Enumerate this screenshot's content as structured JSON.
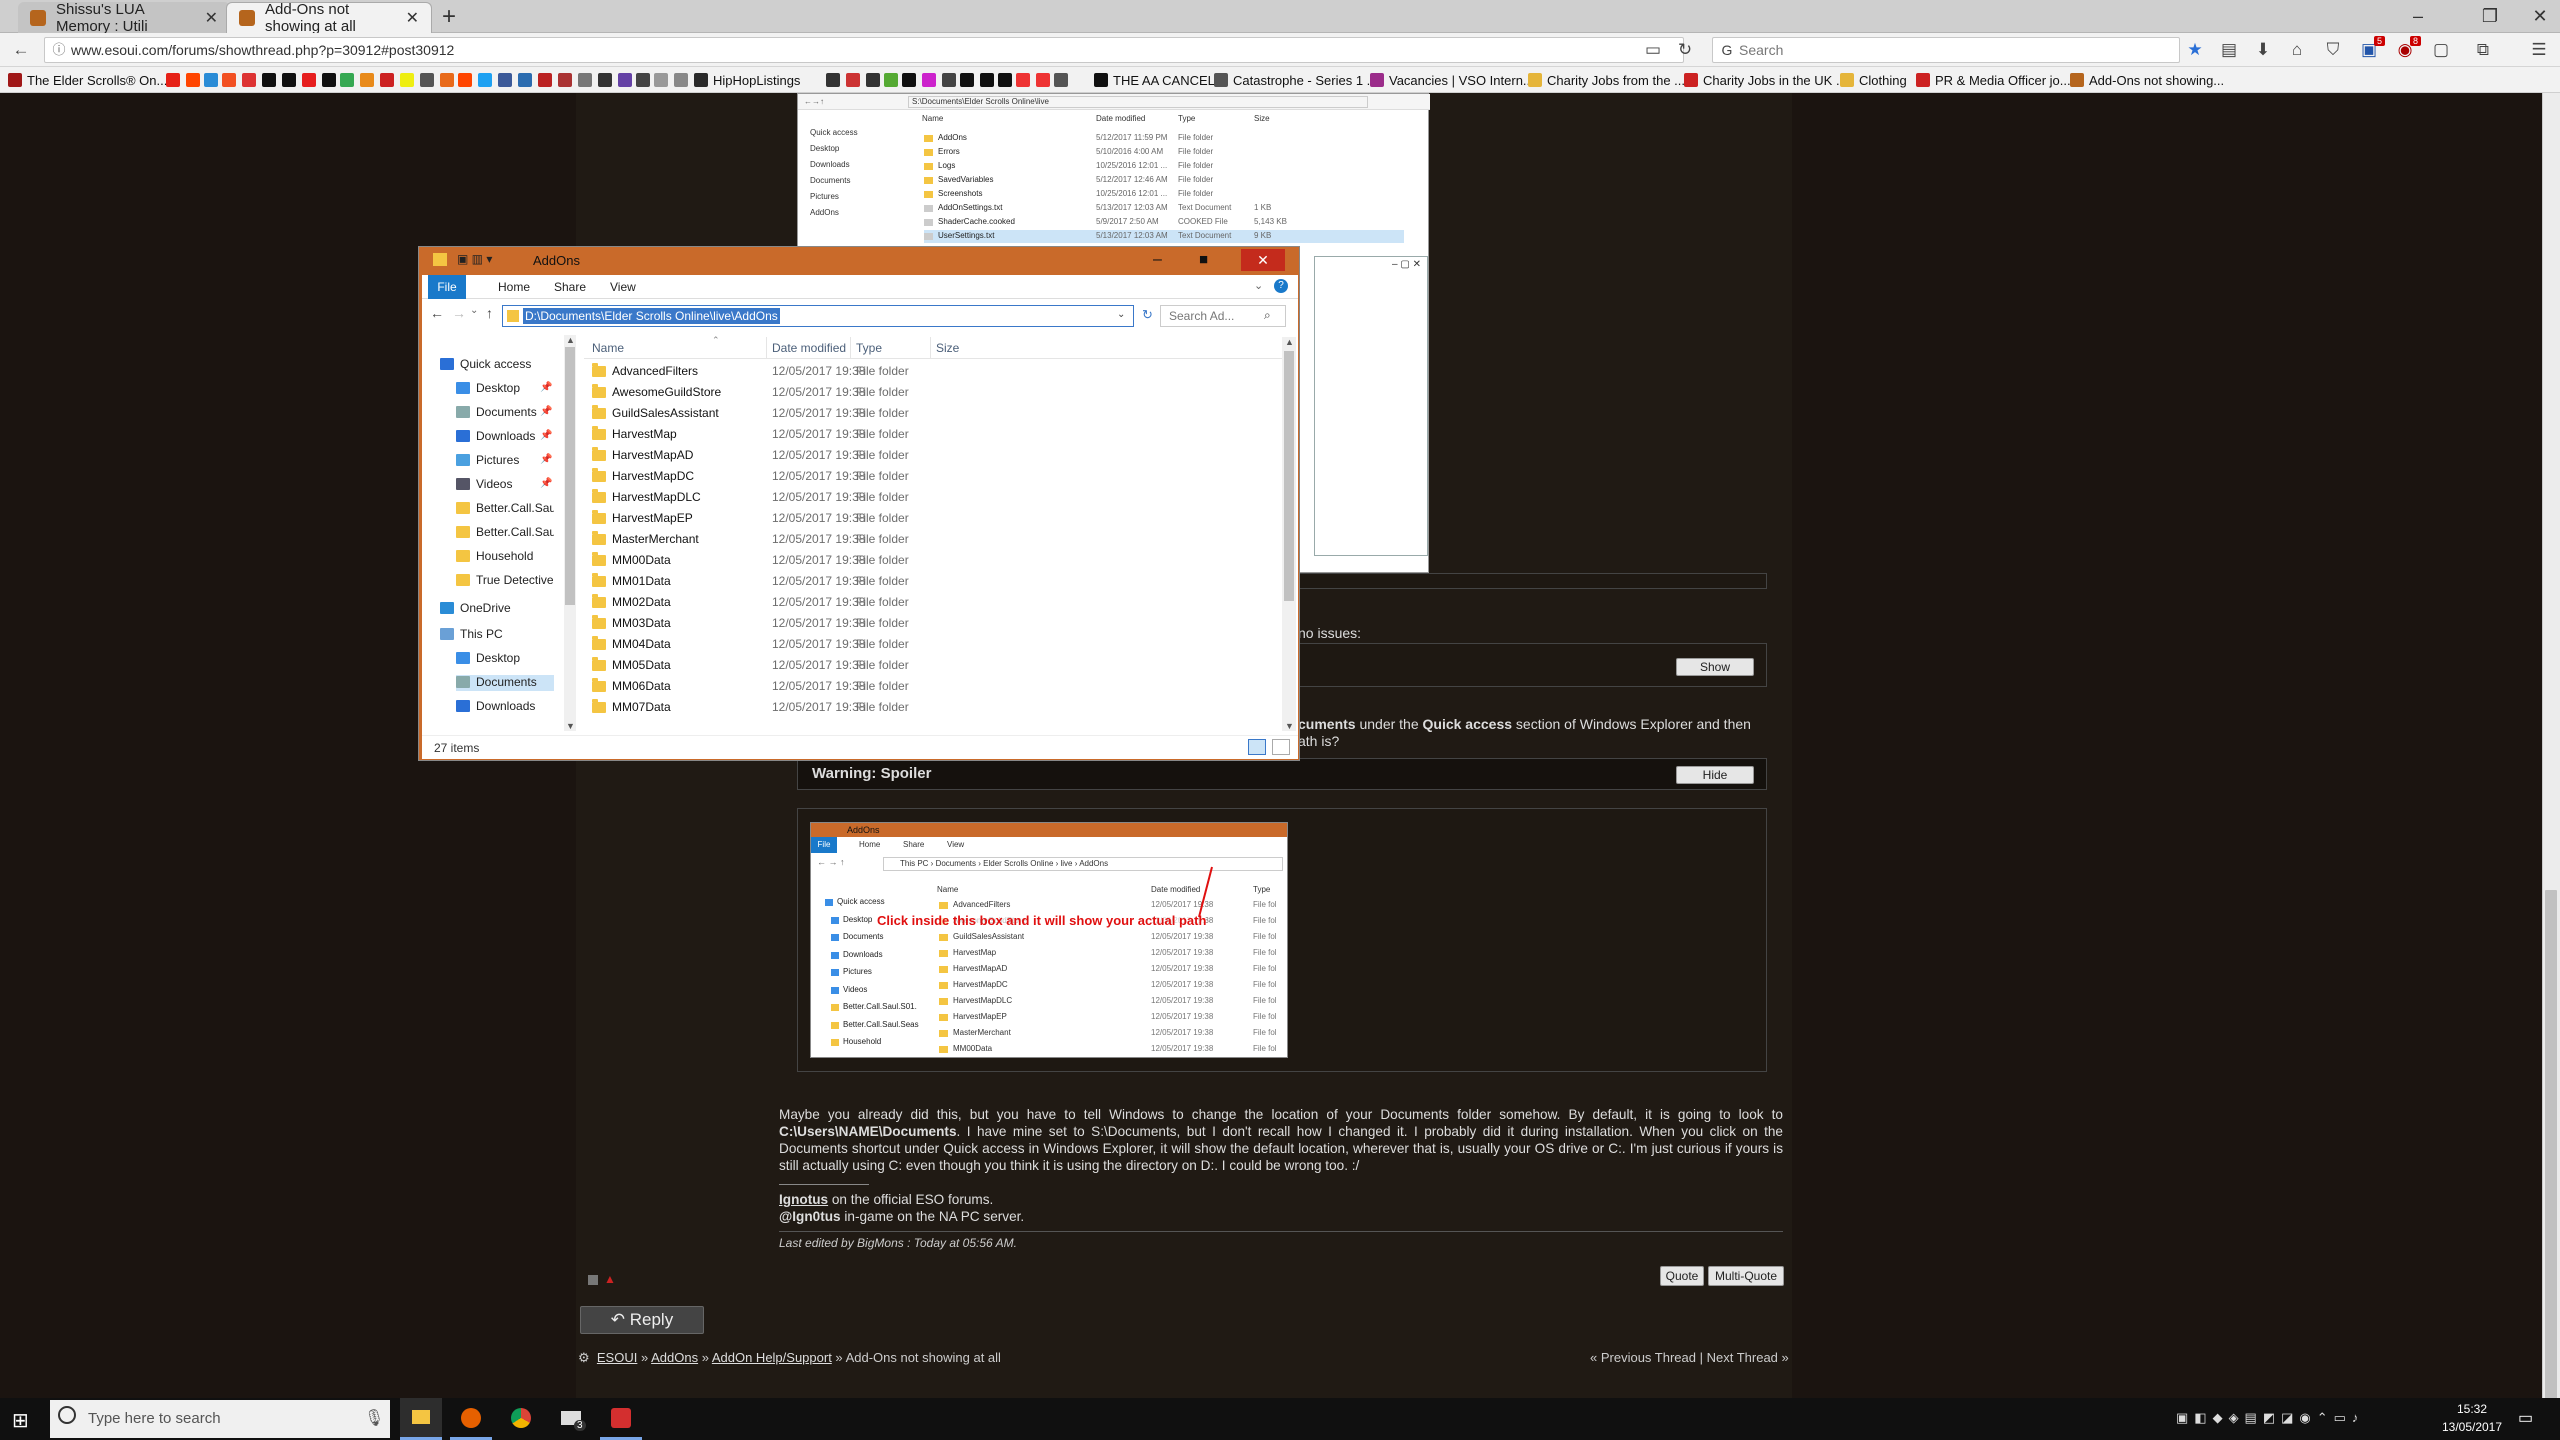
{
  "browser": {
    "tabs": [
      {
        "title": "Shissu's LUA Memory : Utili",
        "active": false
      },
      {
        "title": "Add-Ons not showing at all",
        "active": true
      }
    ],
    "url": "www.esoui.com/forums/showthread.php?p=30912#post30912",
    "search_placeholder": "Search",
    "bookmarks": [
      "The Elder Scrolls® On...",
      "HipHopListings",
      "THE AA CANCEL",
      "Catastrophe - Series 1 ...",
      "Vacancies | VSO Intern...",
      "Charity Jobs from the ...",
      "Charity Jobs in the UK ...",
      "Clothing",
      "PR & Media Officer jo...",
      "Add-Ons not showing..."
    ],
    "badge_counts": [
      "5",
      "8"
    ]
  },
  "explorer": {
    "title": "AddOns",
    "ribbon_tabs": [
      "File",
      "Home",
      "Share",
      "View"
    ],
    "address": "D:\\Documents\\Elder Scrolls Online\\live\\AddOns",
    "search_placeholder": "Search Ad...",
    "columns": [
      "Name",
      "Date modified",
      "Type",
      "Size"
    ],
    "nav": [
      {
        "label": "Quick access"
      },
      {
        "label": "Desktop"
      },
      {
        "label": "Documents"
      },
      {
        "label": "Downloads"
      },
      {
        "label": "Pictures"
      },
      {
        "label": "Videos"
      },
      {
        "label": "Better.Call.Saul.S"
      },
      {
        "label": "Better.Call.Saul.S"
      },
      {
        "label": "Household"
      },
      {
        "label": "True Detective S"
      },
      {
        "label": "OneDrive"
      },
      {
        "label": "This PC"
      },
      {
        "label": "Desktop"
      },
      {
        "label": "Documents"
      },
      {
        "label": "Downloads"
      }
    ],
    "files": [
      "AdvancedFilters",
      "AwesomeGuildStore",
      "GuildSalesAssistant",
      "HarvestMap",
      "HarvestMapAD",
      "HarvestMapDC",
      "HarvestMapDLC",
      "HarvestMapEP",
      "MasterMerchant",
      "MM00Data",
      "MM01Data",
      "MM02Data",
      "MM03Data",
      "MM04Data",
      "MM05Data",
      "MM06Data",
      "MM07Data"
    ],
    "file_date": "12/05/2017 19:38",
    "file_type": "File folder",
    "status": "27 items"
  },
  "bg_explorer": {
    "address": "S:\\Documents\\Elder Scrolls Online\\live",
    "columns": [
      "Name",
      "Date modified",
      "Type",
      "Size"
    ],
    "nav": [
      "Quick access",
      "Desktop",
      "Downloads",
      "Documents",
      "Pictures",
      "AddOns"
    ],
    "rows": [
      {
        "name": "AddOns",
        "date": "5/12/2017 11:59 PM",
        "type": "File folder",
        "size": ""
      },
      {
        "name": "Errors",
        "date": "5/10/2016 4:00 AM",
        "type": "File folder",
        "size": ""
      },
      {
        "name": "Logs",
        "date": "10/25/2016 12:01 ...",
        "type": "File folder",
        "size": ""
      },
      {
        "name": "SavedVariables",
        "date": "5/12/2017 12:46 AM",
        "type": "File folder",
        "size": ""
      },
      {
        "name": "Screenshots",
        "date": "10/25/2016 12:01 ...",
        "type": "File folder",
        "size": ""
      },
      {
        "name": "AddOnSettings.txt",
        "date": "5/13/2017 12:03 AM",
        "type": "Text Document",
        "size": "1 KB"
      },
      {
        "name": "ShaderCache.cooked",
        "date": "5/9/2017 2:50 AM",
        "type": "COOKED File",
        "size": "5,143 KB"
      },
      {
        "name": "UserSettings.txt",
        "date": "5/13/2017 12:03 AM",
        "type": "Text Document",
        "size": "9 KB"
      }
    ]
  },
  "post": {
    "partial_line_1": "no issues:",
    "show_label": "Show",
    "partial_line_2_bold_a": "cuments",
    "partial_line_2_mid": " under the ",
    "partial_line_2_bold_b": "Quick access",
    "partial_line_2_end": " section of Windows Explorer and then",
    "partial_line_3": "ath is?",
    "spoiler_title": "Warning: Spoiler",
    "hide_label": "Hide",
    "body_text": "Maybe you already did this, but you have to tell Windows to change the location of your Documents folder somehow. By default, it is going to look to",
    "body_bold_path": "C:\\Users\\NAME\\Documents",
    "body_text_2": ". I have mine set to S:\\Documents, but I don't recall how I changed it. I probably did it during installation. When you click on the Documents shortcut under Quick access in Windows Explorer, it will show the default location, wherever that is, usually your OS drive or C:. I'm just curious if yours is still actually using C: even though you think it is using the directory on D:. I could be wrong too. :/",
    "sig_name": "Ignotus",
    "sig_line_1": " on the official ESO forums.",
    "sig_handle": "@Ign0tus",
    "sig_line_2": " in-game on the NA PC server.",
    "last_edited": "Last edited by BigMons : Today at 05:56 AM.",
    "quote_label": "Quote",
    "multiquote_label": "Multi-Quote",
    "reply_label": "Reply"
  },
  "spoiler_image": {
    "title": "AddOns",
    "ribbon_tabs": [
      "File",
      "Home",
      "Share",
      "View"
    ],
    "crumbs": [
      "This PC",
      "Documents",
      "Elder Scrolls Online",
      "live",
      "AddOns"
    ],
    "columns": [
      "Name",
      "Date modified",
      "Type"
    ],
    "annotation": "Click inside this box and it will show your actual path",
    "nav": [
      "Quick access",
      "Desktop",
      "Documents",
      "Downloads",
      "Pictures",
      "Videos",
      "Better.Call.Saul.S01.",
      "Better.Call.Saul.Seas",
      "Household"
    ],
    "files": [
      "AdvancedFilters",
      "AwesomeGuildStore",
      "GuildSalesAssistant",
      "HarvestMap",
      "HarvestMapAD",
      "HarvestMapDC",
      "HarvestMapDLC",
      "HarvestMapEP",
      "MasterMerchant",
      "MM00Data"
    ],
    "date": "12/05/2017 19:38",
    "type": "File fol"
  },
  "breadcrumb": {
    "items": [
      "ESOUI",
      "AddOns",
      "AddOn Help/Support"
    ],
    "current": "Add-Ons not showing at all",
    "prev": "Previous Thread",
    "next": "Next Thread"
  },
  "taskbar": {
    "search_placeholder": "Type here to search",
    "time": "15:32",
    "date": "13/05/2017",
    "mail_badge": "3"
  },
  "colors": {
    "accent": "#c96a2a",
    "page_bg": "#1b1410",
    "selection": "#3a78c9",
    "annotation": "#e01010"
  }
}
